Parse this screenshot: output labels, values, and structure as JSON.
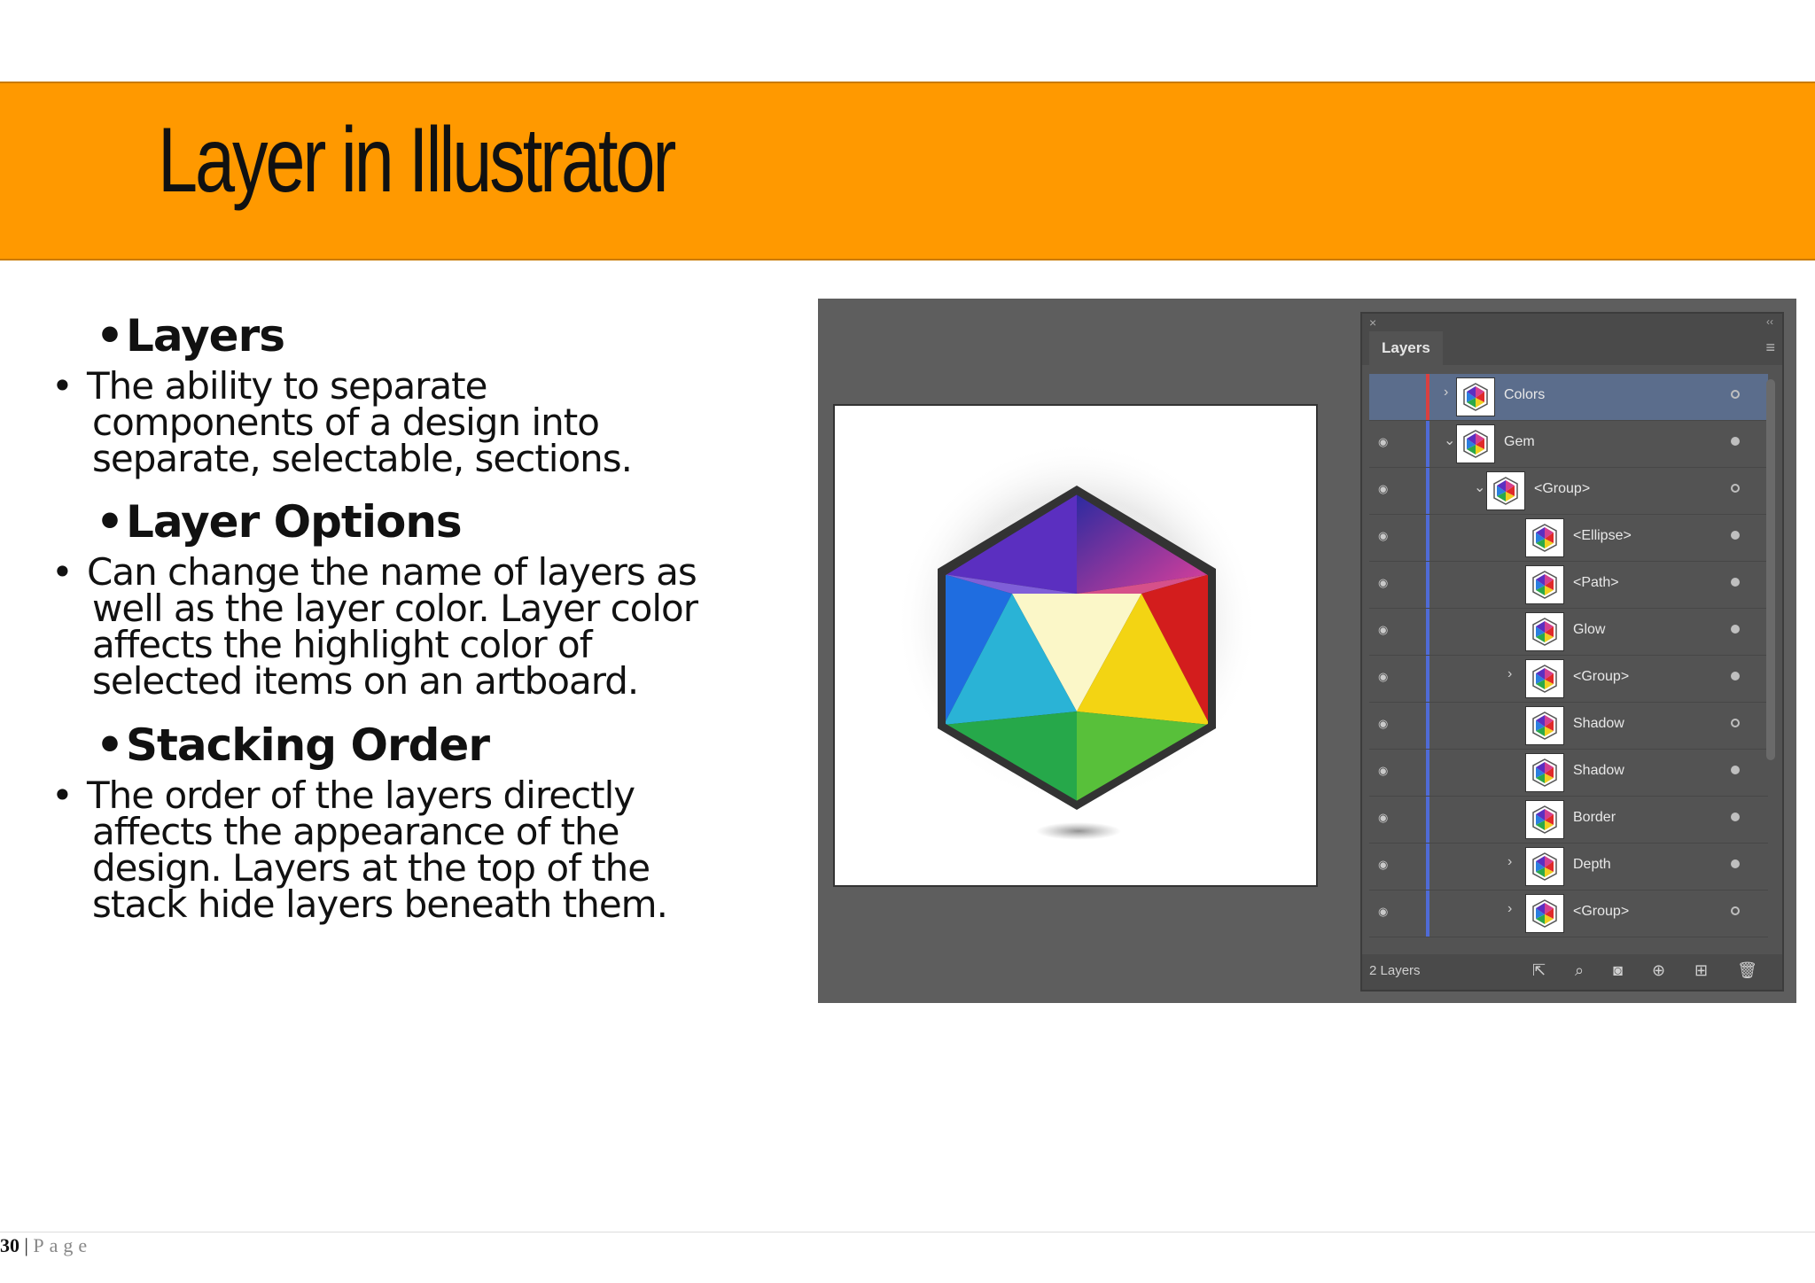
{
  "title": "Layer in Illustrator",
  "sections": [
    {
      "heading": "Layers",
      "lines": [
        "The ability to separate",
        "components of a design into",
        "separate, selectable, sections."
      ]
    },
    {
      "heading": "Layer Options",
      "lines": [
        "Can change the name of layers as",
        "well as the layer color. Layer color",
        "affects the highlight color of",
        "selected items on an artboard."
      ]
    },
    {
      "heading": "Stacking Order",
      "lines": [
        "The order of the layers directly",
        "affects the appearance of the",
        "design. Layers at the top of the",
        "stack hide layers beneath them."
      ]
    }
  ],
  "bullet": "•",
  "panel": {
    "tab": "Layers",
    "close": "×",
    "collapse": "‹‹",
    "menu": "≡",
    "layer_count": "2 Layers",
    "footer_icons": "⇱ ⌕ ◙ ⊕ ⊞ 🗑",
    "rows": [
      {
        "name": "Colors",
        "selected": true,
        "eye": false,
        "chevron": "›",
        "filled": false
      },
      {
        "name": "Gem",
        "selected": false,
        "eye": true,
        "chevron": "⌄",
        "filled": true
      },
      {
        "name": "<Group>",
        "selected": false,
        "eye": true,
        "chevron": "⌄",
        "filled": false
      },
      {
        "name": "<Ellipse>",
        "selected": false,
        "eye": true,
        "chevron": "",
        "filled": true
      },
      {
        "name": "<Path>",
        "selected": false,
        "eye": true,
        "chevron": "",
        "filled": true
      },
      {
        "name": "Glow",
        "selected": false,
        "eye": true,
        "chevron": "",
        "filled": true
      },
      {
        "name": "<Group>",
        "selected": false,
        "eye": true,
        "chevron": "›",
        "filled": true
      },
      {
        "name": "Shadow",
        "selected": false,
        "eye": true,
        "chevron": "",
        "filled": false
      },
      {
        "name": "Shadow",
        "selected": false,
        "eye": true,
        "chevron": "",
        "filled": true
      },
      {
        "name": "Border",
        "selected": false,
        "eye": true,
        "chevron": "",
        "filled": true
      },
      {
        "name": "Depth",
        "selected": false,
        "eye": true,
        "chevron": "›",
        "filled": true
      },
      {
        "name": "<Group>",
        "selected": false,
        "eye": true,
        "chevron": "›",
        "filled": false
      }
    ]
  },
  "footer": {
    "page": "30",
    "separator": " | ",
    "label": "Page"
  }
}
